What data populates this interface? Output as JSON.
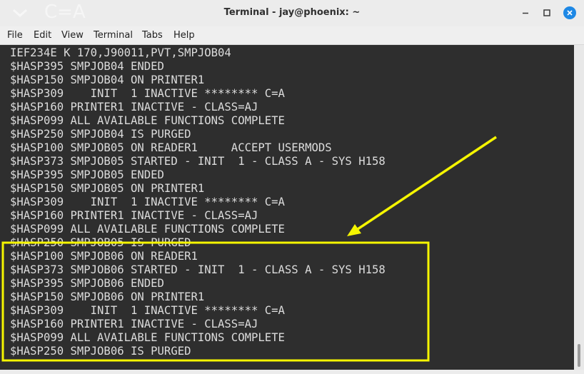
{
  "window": {
    "title": "Terminal - jay@phoenix: ~",
    "ghost_overlay": "C=A"
  },
  "menu": {
    "items": [
      "File",
      "Edit",
      "View",
      "Terminal",
      "Tabs",
      "Help"
    ]
  },
  "terminal": {
    "lines": [
      "IEF234E K 170,J90011,PVT,SMPJOB04",
      "$HASP395 SMPJOB04 ENDED",
      "$HASP150 SMPJOB04 ON PRINTER1",
      "$HASP309    INIT  1 INACTIVE ******** C=A",
      "$HASP160 PRINTER1 INACTIVE - CLASS=AJ",
      "$HASP099 ALL AVAILABLE FUNCTIONS COMPLETE",
      "$HASP250 SMPJOB04 IS PURGED",
      "$HASP100 SMPJOB05 ON READER1     ACCEPT USERMODS",
      "$HASP373 SMPJOB05 STARTED - INIT  1 - CLASS A - SYS H158",
      "$HASP395 SMPJOB05 ENDED",
      "$HASP150 SMPJOB05 ON PRINTER1",
      "$HASP309    INIT  1 INACTIVE ******** C=A",
      "$HASP160 PRINTER1 INACTIVE - CLASS=AJ",
      "$HASP099 ALL AVAILABLE FUNCTIONS COMPLETE",
      "$HASP250 SMPJOB05 IS PURGED",
      "$HASP100 SMPJOB06 ON READER1",
      "$HASP373 SMPJOB06 STARTED - INIT  1 - CLASS A - SYS H158",
      "$HASP395 SMPJOB06 ENDED",
      "$HASP150 SMPJOB06 ON PRINTER1",
      "$HASP309    INIT  1 INACTIVE ******** C=A",
      "$HASP160 PRINTER1 INACTIVE - CLASS=AJ",
      "$HASP099 ALL AVAILABLE FUNCTIONS COMPLETE",
      "$HASP250 SMPJOB06 IS PURGED"
    ],
    "scroll_position": 1.0
  },
  "annotation": {
    "color": "#f5f500"
  },
  "colors": {
    "close_button": "#1e88e5"
  }
}
